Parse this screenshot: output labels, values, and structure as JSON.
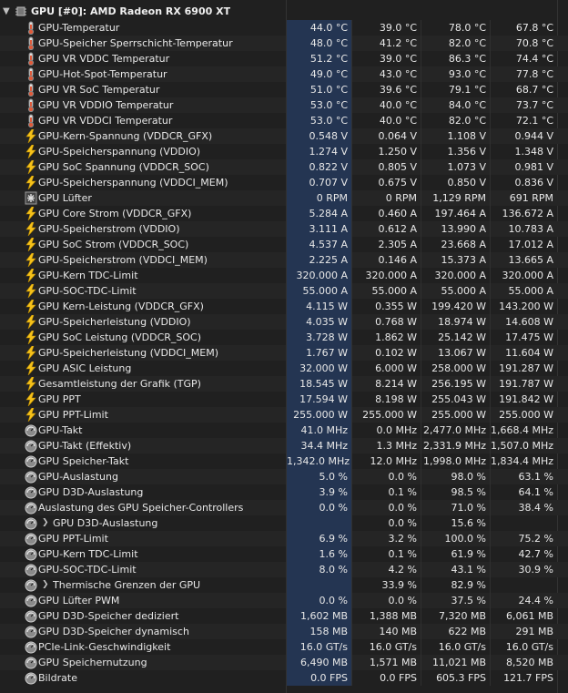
{
  "group": {
    "title": "GPU [#0]: AMD Radeon RX 6900 XT",
    "expanded_icon": "chevron-down-icon",
    "device_icon": "chip-icon"
  },
  "rows": [
    {
      "label": "GPU-Temperatur",
      "icon": "thermometer",
      "v": [
        "44.0 °C",
        "39.0 °C",
        "78.0 °C",
        "67.8 °C"
      ]
    },
    {
      "label": "GPU-Speicher Sperrschicht-Temperatur",
      "icon": "thermometer",
      "v": [
        "48.0 °C",
        "41.2 °C",
        "82.0 °C",
        "70.8 °C"
      ]
    },
    {
      "label": "GPU VR VDDC Temperatur",
      "icon": "thermometer",
      "v": [
        "51.2 °C",
        "39.0 °C",
        "86.3 °C",
        "74.4 °C"
      ]
    },
    {
      "label": "GPU-Hot-Spot-Temperatur",
      "icon": "thermometer",
      "v": [
        "49.0 °C",
        "43.0 °C",
        "93.0 °C",
        "77.8 °C"
      ]
    },
    {
      "label": "GPU VR SoC Temperatur",
      "icon": "thermometer",
      "v": [
        "51.0 °C",
        "39.6 °C",
        "79.1 °C",
        "68.7 °C"
      ]
    },
    {
      "label": "GPU VR VDDIO Temperatur",
      "icon": "thermometer",
      "v": [
        "53.0 °C",
        "40.0 °C",
        "84.0 °C",
        "73.7 °C"
      ]
    },
    {
      "label": "GPU VR VDDCI Temperatur",
      "icon": "thermometer",
      "v": [
        "53.0 °C",
        "40.0 °C",
        "82.0 °C",
        "72.1 °C"
      ]
    },
    {
      "label": "GPU-Kern-Spannung (VDDCR_GFX)",
      "icon": "bolt",
      "v": [
        "0.548 V",
        "0.064 V",
        "1.108 V",
        "0.944 V"
      ]
    },
    {
      "label": "GPU-Speicherspannung (VDDIO)",
      "icon": "bolt",
      "v": [
        "1.274 V",
        "1.250 V",
        "1.356 V",
        "1.348 V"
      ]
    },
    {
      "label": "GPU SoC Spannung (VDDCR_SOC)",
      "icon": "bolt",
      "v": [
        "0.822 V",
        "0.805 V",
        "1.073 V",
        "0.981 V"
      ]
    },
    {
      "label": "GPU-Speicherspannung (VDDCI_MEM)",
      "icon": "bolt",
      "v": [
        "0.707 V",
        "0.675 V",
        "0.850 V",
        "0.836 V"
      ]
    },
    {
      "label": "GPU Lüfter",
      "icon": "fan",
      "v": [
        "0 RPM",
        "0 RPM",
        "1,129 RPM",
        "691 RPM"
      ]
    },
    {
      "label": "GPU Core Strom (VDDCR_GFX)",
      "icon": "bolt",
      "v": [
        "5.284 A",
        "0.460 A",
        "197.464 A",
        "136.672 A"
      ]
    },
    {
      "label": "GPU-Speicherstrom (VDDIO)",
      "icon": "bolt",
      "v": [
        "3.111 A",
        "0.612 A",
        "13.990 A",
        "10.783 A"
      ]
    },
    {
      "label": "GPU SoC Strom (VDDCR_SOC)",
      "icon": "bolt",
      "v": [
        "4.537 A",
        "2.305 A",
        "23.668 A",
        "17.012 A"
      ]
    },
    {
      "label": "GPU-Speicherstrom (VDDCI_MEM)",
      "icon": "bolt",
      "v": [
        "2.225 A",
        "0.146 A",
        "15.373 A",
        "13.665 A"
      ]
    },
    {
      "label": "GPU-Kern TDC-Limit",
      "icon": "bolt",
      "v": [
        "320.000 A",
        "320.000 A",
        "320.000 A",
        "320.000 A"
      ]
    },
    {
      "label": "GPU-SOC-TDC-Limit",
      "icon": "bolt",
      "v": [
        "55.000 A",
        "55.000 A",
        "55.000 A",
        "55.000 A"
      ]
    },
    {
      "label": "GPU Kern-Leistung (VDDCR_GFX)",
      "icon": "bolt",
      "v": [
        "4.115 W",
        "0.355 W",
        "199.420 W",
        "143.200 W"
      ]
    },
    {
      "label": "GPU-Speicherleistung (VDDIO)",
      "icon": "bolt",
      "v": [
        "4.035 W",
        "0.768 W",
        "18.974 W",
        "14.608 W"
      ]
    },
    {
      "label": "GPU SoC Leistung (VDDCR_SOC)",
      "icon": "bolt",
      "v": [
        "3.728 W",
        "1.862 W",
        "25.142 W",
        "17.475 W"
      ]
    },
    {
      "label": "GPU-Speicherleistung (VDDCI_MEM)",
      "icon": "bolt",
      "v": [
        "1.767 W",
        "0.102 W",
        "13.067 W",
        "11.604 W"
      ]
    },
    {
      "label": "GPU ASIC Leistung",
      "icon": "bolt",
      "v": [
        "32.000 W",
        "6.000 W",
        "258.000 W",
        "191.287 W"
      ]
    },
    {
      "label": "Gesamtleistung der Grafik (TGP)",
      "icon": "bolt",
      "v": [
        "18.545 W",
        "8.214 W",
        "256.195 W",
        "191.787 W"
      ]
    },
    {
      "label": "GPU PPT",
      "icon": "bolt",
      "v": [
        "17.594 W",
        "8.198 W",
        "255.043 W",
        "191.842 W"
      ]
    },
    {
      "label": "GPU PPT-Limit",
      "icon": "bolt",
      "v": [
        "255.000 W",
        "255.000 W",
        "255.000 W",
        "255.000 W"
      ]
    },
    {
      "label": "GPU-Takt",
      "icon": "gauge",
      "v": [
        "41.0 MHz",
        "0.0 MHz",
        "2,477.0 MHz",
        "1,668.4 MHz"
      ]
    },
    {
      "label": "GPU-Takt (Effektiv)",
      "icon": "gauge",
      "v": [
        "34.4 MHz",
        "1.3 MHz",
        "2,331.9 MHz",
        "1,507.0 MHz"
      ]
    },
    {
      "label": "GPU Speicher-Takt",
      "icon": "gauge",
      "v": [
        "1,342.0 MHz",
        "12.0 MHz",
        "1,998.0 MHz",
        "1,834.4 MHz"
      ]
    },
    {
      "label": "GPU-Auslastung",
      "icon": "gauge",
      "v": [
        "5.0 %",
        "0.0 %",
        "98.0 %",
        "63.1 %"
      ]
    },
    {
      "label": "GPU D3D-Auslastung",
      "icon": "gauge",
      "v": [
        "3.9 %",
        "0.1 %",
        "98.5 %",
        "64.1 %"
      ]
    },
    {
      "label": "Auslastung des GPU Speicher-Controllers",
      "icon": "gauge",
      "v": [
        "0.0 %",
        "0.0 %",
        "71.0 %",
        "38.4 %"
      ]
    },
    {
      "label": "GPU D3D-Auslastung",
      "icon": "gauge",
      "sub": true,
      "v": [
        "",
        "0.0 %",
        "15.6 %",
        ""
      ]
    },
    {
      "label": "GPU PPT-Limit",
      "icon": "gauge",
      "v": [
        "6.9 %",
        "3.2 %",
        "100.0 %",
        "75.2 %"
      ]
    },
    {
      "label": "GPU-Kern TDC-Limit",
      "icon": "gauge",
      "v": [
        "1.6 %",
        "0.1 %",
        "61.9 %",
        "42.7 %"
      ]
    },
    {
      "label": "GPU-SOC-TDC-Limit",
      "icon": "gauge",
      "v": [
        "8.0 %",
        "4.2 %",
        "43.1 %",
        "30.9 %"
      ]
    },
    {
      "label": "Thermische Grenzen der GPU",
      "icon": "gauge",
      "sub": true,
      "v": [
        "",
        "33.9 %",
        "82.9 %",
        ""
      ]
    },
    {
      "label": "GPU Lüfter PWM",
      "icon": "gauge",
      "v": [
        "0.0 %",
        "0.0 %",
        "37.5 %",
        "24.4 %"
      ]
    },
    {
      "label": "GPU D3D-Speicher dediziert",
      "icon": "gauge",
      "v": [
        "1,602 MB",
        "1,388 MB",
        "7,320 MB",
        "6,061 MB"
      ]
    },
    {
      "label": "GPU D3D-Speicher dynamisch",
      "icon": "gauge",
      "v": [
        "158 MB",
        "140 MB",
        "622 MB",
        "291 MB"
      ]
    },
    {
      "label": "PCIe-Link-Geschwindigkeit",
      "icon": "gauge",
      "v": [
        "16.0 GT/s",
        "16.0 GT/s",
        "16.0 GT/s",
        "16.0 GT/s"
      ]
    },
    {
      "label": "GPU Speichernutzung",
      "icon": "gauge",
      "v": [
        "6,490 MB",
        "1,571 MB",
        "11,021 MB",
        "8,520 MB"
      ]
    },
    {
      "label": "Bildrate",
      "icon": "gauge",
      "v": [
        "0.0 FPS",
        "0.0 FPS",
        "605.3 FPS",
        "121.7 FPS"
      ]
    }
  ],
  "colors": {
    "background": "#202020",
    "current_column": "#243552",
    "text": "#e8e8e8",
    "bolt": "#f6c21b",
    "thermo": "#e05a3a"
  }
}
